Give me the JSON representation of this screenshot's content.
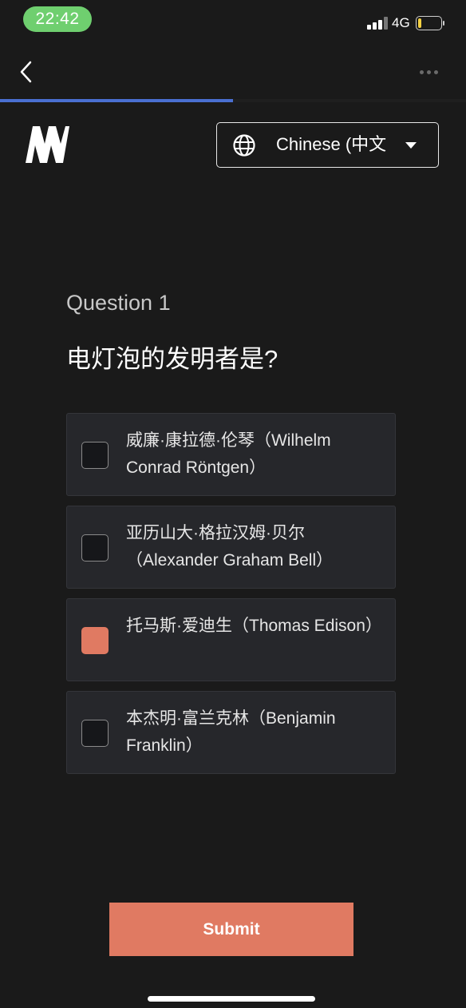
{
  "status_bar": {
    "time": "22:42",
    "network": "4G",
    "battery_level": 0.15,
    "colors": {
      "time_pill": "#6fcf6f",
      "battery": "#f5d142"
    }
  },
  "nav": {
    "back_icon": "chevron-left-icon",
    "more_icon": "more-horizontal-icon",
    "progress": 0.5,
    "colors": {
      "progress": "#4a6fd1"
    }
  },
  "header": {
    "logo_icon": "brand-logo-icon",
    "language": {
      "icon": "globe-icon",
      "selected": "Chinese (中文",
      "caret_icon": "caret-down-icon"
    }
  },
  "quiz": {
    "question_label": "Question 1",
    "question_text": "电灯泡的发明者是?",
    "options": [
      {
        "label": "威廉·康拉德·伦琴（Wilhelm Conrad Röntgen）",
        "selected": false
      },
      {
        "label": "亚历山大·格拉汉姆·贝尔（Alexander Graham Bell）",
        "selected": false
      },
      {
        "label": "托马斯·爱迪生（Thomas Edison）",
        "selected": true
      },
      {
        "label": "本杰明·富兰克林（Benjamin Franklin）",
        "selected": false
      }
    ],
    "submit_label": "Submit",
    "colors": {
      "accent": "#e07a62",
      "background": "#1a1a1a",
      "option_bg": "#26272b"
    }
  }
}
